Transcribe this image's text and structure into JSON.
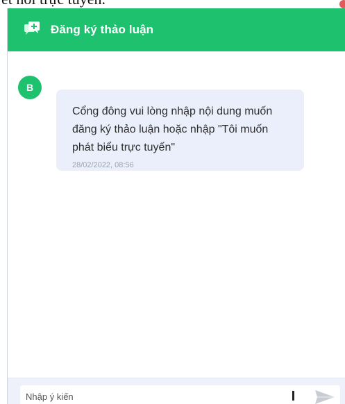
{
  "doc": {
    "peek_text": "ết nối trực tuyến."
  },
  "chat": {
    "header_title": "Đăng ký thảo luận",
    "header_icon": "chat-plus-icon",
    "accent_color": "#1ec16e",
    "messages": [
      {
        "avatar_letter": "B",
        "text": "Cổng đông vui lòng nhập nội dung muốn đăng ký thảo luận hoặc nhập \"Tôi muốn phát biểu trực tuyến\"",
        "time": "28/02/2022, 08:56"
      }
    ],
    "input": {
      "placeholder": "Nhập ý kiến",
      "value": ""
    },
    "send_icon": "send-icon",
    "close_icon": "close-icon"
  }
}
